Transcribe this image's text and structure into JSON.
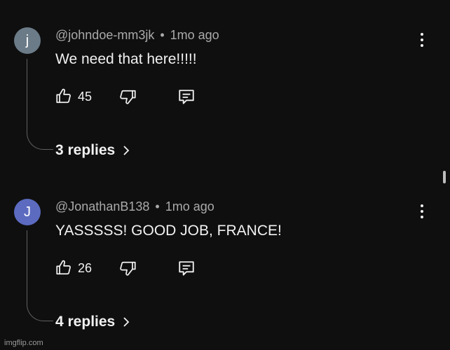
{
  "comments": [
    {
      "avatar_letter": "j",
      "avatar_color": "#6b7b88",
      "handle": "@johndoe-mm3jk",
      "separator": "•",
      "time": "1mo ago",
      "text": "We need that here!!!!!",
      "likes": "45",
      "replies_label": "3 replies"
    },
    {
      "avatar_letter": "J",
      "avatar_color": "#5c6bc0",
      "handle": "@JonathanB138",
      "separator": "•",
      "time": "1mo ago",
      "text": "YASSSSS! GOOD JOB, FRANCE!",
      "likes": "26",
      "replies_label": "4 replies"
    }
  ],
  "icons": {
    "like": "thumbs-up-icon",
    "dislike": "thumbs-down-icon",
    "reply": "reply-comment-icon",
    "menu": "more-vertical-icon",
    "chevron": "chevron-right-icon"
  },
  "watermark": "imgflip.com"
}
